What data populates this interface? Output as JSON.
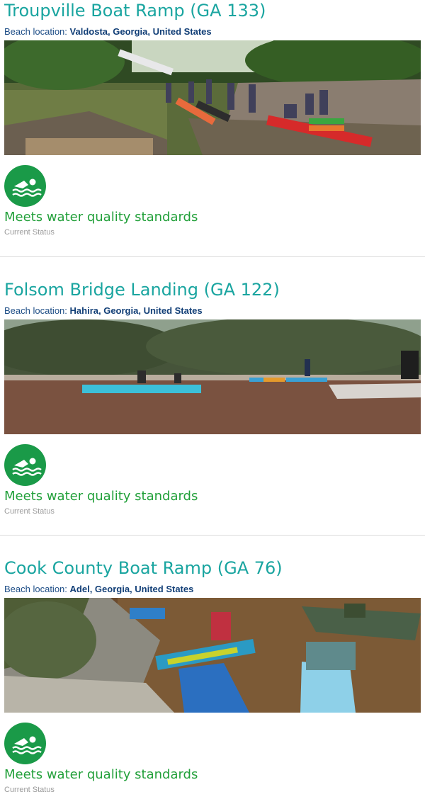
{
  "entries": [
    {
      "title": "Troupville Boat Ramp (GA 133)",
      "location_label": "Beach location:",
      "location": "Valdosta, Georgia, United States",
      "photo_icon": "boat-ramp-photo",
      "status_icon": "swimmer-icon",
      "status": "Meets water quality standards",
      "status_label": "Current Status"
    },
    {
      "title": "Folsom Bridge Landing (GA 122)",
      "location_label": "Beach location:",
      "location": "Hahira, Georgia, United States",
      "photo_icon": "river-kayaks-photo",
      "status_icon": "swimmer-icon",
      "status": "Meets water quality standards",
      "status_label": "Current Status"
    },
    {
      "title": "Cook County Boat Ramp (GA 76)",
      "location_label": "Beach location:",
      "location": "Adel, Georgia, United States",
      "photo_icon": "kayakers-photo",
      "status_icon": "swimmer-icon",
      "status": "Meets water quality standards",
      "status_label": "Current Status"
    }
  ],
  "colors": {
    "title": "#1aa5a0",
    "location": "#123f77",
    "status": "#22a03a",
    "status_badge": "#1a9a48"
  }
}
